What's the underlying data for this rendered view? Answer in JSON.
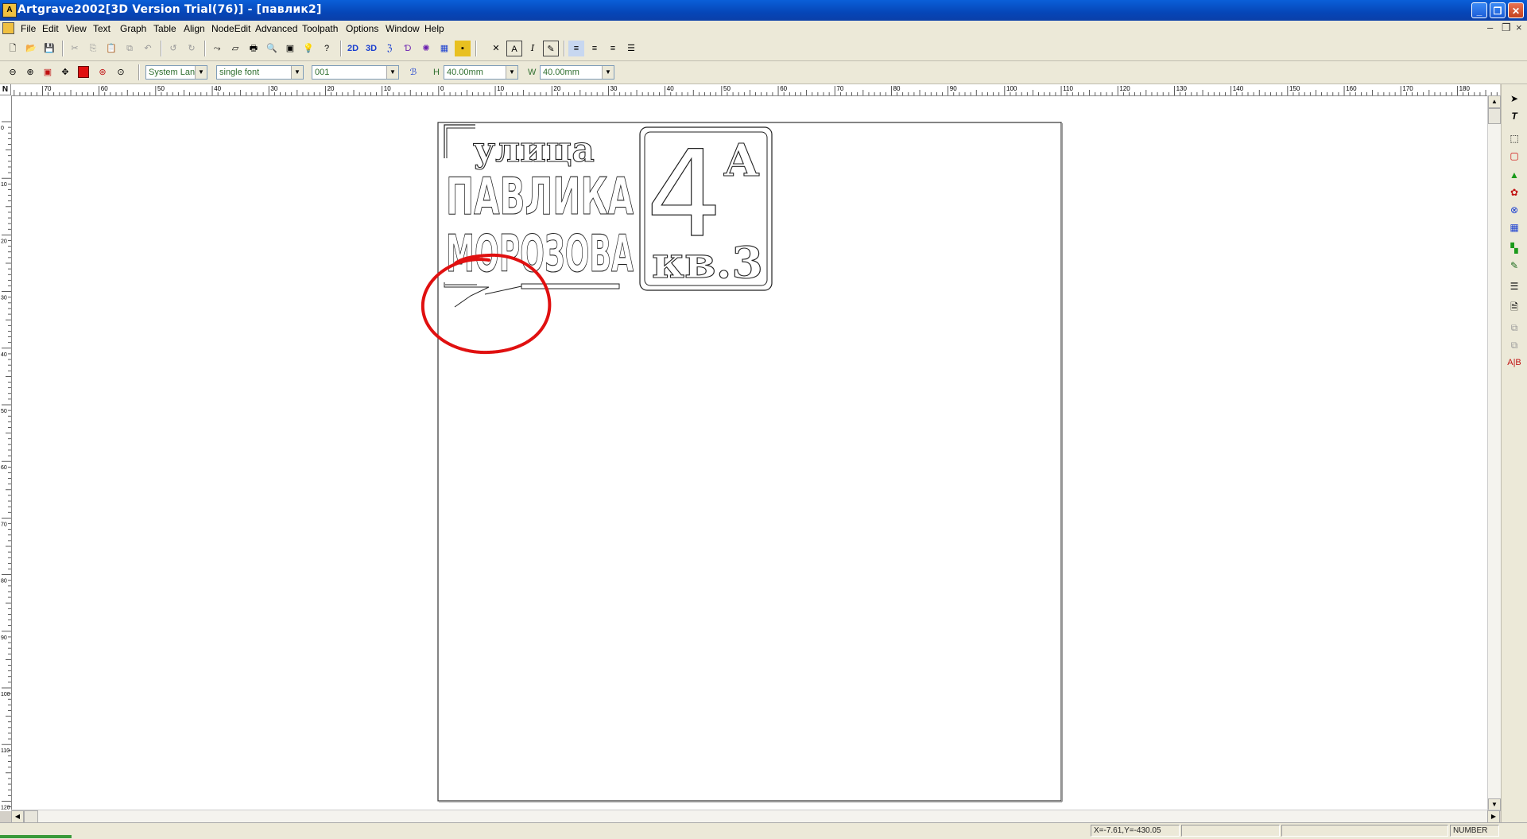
{
  "window": {
    "title": "Artgrave2002[3D Version Trial(76)] - [павлик2]",
    "app_icon": "A",
    "controls": [
      "_",
      "❐",
      "✕"
    ]
  },
  "menubar": {
    "items": [
      "File",
      "Edit",
      "View",
      "Text",
      "Graph",
      "Table",
      "Align",
      "NodeEdit",
      "Advanced",
      "Toolpath",
      "Options",
      "Window",
      "Help"
    ],
    "mdi_controls": [
      "–",
      "❐",
      "×"
    ]
  },
  "toolbar1": {
    "buttons": [
      "new-file",
      "open-file",
      "save",
      "cut",
      "copy",
      "paste",
      "paste-special",
      "undo-history",
      "undo",
      "redo",
      "scan",
      "toolpath",
      "print",
      "print-preview",
      "preview",
      "light-bulb",
      "help",
      "2D",
      "3D",
      "3D-letter",
      "3D-view",
      "3D-render",
      "grid",
      "color-table",
      "node-edit",
      "text-frame",
      "italic",
      "edit-box",
      "align-left",
      "align-center",
      "align-right",
      "justify"
    ]
  },
  "toolbar2": {
    "font_language": "System Lan",
    "font_name": "single font",
    "style_code": "001",
    "height_label": "H",
    "height_value": "40.00mm",
    "width_label": "W",
    "width_value": "40.00mm"
  },
  "ruler": {
    "h_labels": [
      "70",
      "60",
      "50",
      "40",
      "30",
      "20",
      "10",
      "0",
      "10",
      "20",
      "30",
      "40",
      "50",
      "60",
      "70",
      "80",
      "90",
      "100",
      "110",
      "120",
      "130",
      "140",
      "150",
      "160",
      "170",
      "180"
    ],
    "v_labels": [
      "0",
      "10",
      "20",
      "30",
      "40",
      "50",
      "60",
      "70",
      "80",
      "90",
      "100",
      "110",
      "120"
    ],
    "corner": "N"
  },
  "drawing": {
    "street_word": "улица",
    "name_line1": "ПАВЛИКА",
    "name_line2": "МОРОЗОВА",
    "house_number": "4",
    "house_letter": "А",
    "apartment": "кв.3",
    "annotation_color": "#e01010"
  },
  "statusbar": {
    "coordinates": "X=-7.61,Y=-430.05",
    "mode": "NUMBER"
  }
}
